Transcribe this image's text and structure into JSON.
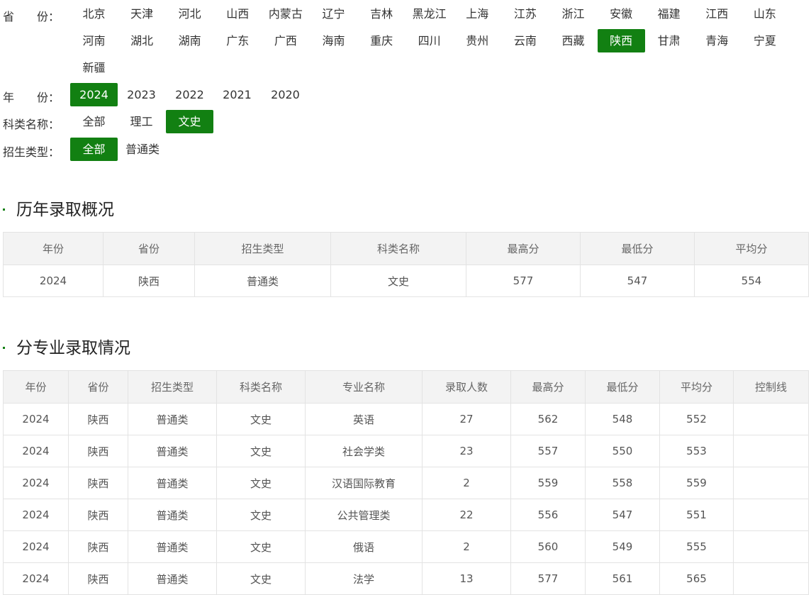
{
  "filters": {
    "province_label": "省　　份：",
    "provinces": [
      "北京",
      "天津",
      "河北",
      "山西",
      "内蒙古",
      "辽宁",
      "吉林",
      "黑龙江",
      "上海",
      "江苏",
      "浙江",
      "安徽",
      "福建",
      "江西",
      "山东",
      "河南",
      "湖北",
      "湖南",
      "广东",
      "广西",
      "海南",
      "重庆",
      "四川",
      "贵州",
      "云南",
      "西藏",
      "陕西",
      "甘肃",
      "青海",
      "宁夏",
      "新疆"
    ],
    "province_selected": "陕西",
    "year_label": "年　　份：",
    "years": [
      "2024",
      "2023",
      "2022",
      "2021",
      "2020"
    ],
    "year_selected": "2024",
    "subject_label": "科类名称：",
    "subjects": [
      "全部",
      "理工",
      "文史"
    ],
    "subject_selected": "文史",
    "type_label": "招生类型：",
    "types": [
      "全部",
      "普通类"
    ],
    "type_selected": "全部"
  },
  "summary": {
    "title": "历年录取概况",
    "headers": [
      "年份",
      "省份",
      "招生类型",
      "科类名称",
      "最高分",
      "最低分",
      "平均分"
    ],
    "rows": [
      [
        "2024",
        "陕西",
        "普通类",
        "文史",
        "577",
        "547",
        "554"
      ]
    ]
  },
  "majors": {
    "title": "分专业录取情况",
    "headers": [
      "年份",
      "省份",
      "招生类型",
      "科类名称",
      "专业名称",
      "录取人数",
      "最高分",
      "最低分",
      "平均分",
      "控制线"
    ],
    "rows": [
      [
        "2024",
        "陕西",
        "普通类",
        "文史",
        "英语",
        "27",
        "562",
        "548",
        "552",
        ""
      ],
      [
        "2024",
        "陕西",
        "普通类",
        "文史",
        "社会学类",
        "23",
        "557",
        "550",
        "553",
        ""
      ],
      [
        "2024",
        "陕西",
        "普通类",
        "文史",
        "汉语国际教育",
        "2",
        "559",
        "558",
        "559",
        ""
      ],
      [
        "2024",
        "陕西",
        "普通类",
        "文史",
        "公共管理类",
        "22",
        "556",
        "547",
        "551",
        ""
      ],
      [
        "2024",
        "陕西",
        "普通类",
        "文史",
        "俄语",
        "2",
        "560",
        "549",
        "555",
        ""
      ],
      [
        "2024",
        "陕西",
        "普通类",
        "文史",
        "法学",
        "13",
        "577",
        "561",
        "565",
        ""
      ]
    ]
  },
  "colors": {
    "accent": "#128012"
  }
}
